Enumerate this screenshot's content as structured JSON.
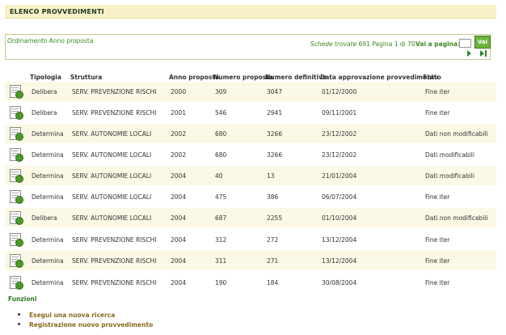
{
  "page": {
    "title": "ELENCO PROVVEDIMENTI"
  },
  "pager": {
    "sort_label": "Ordinamento",
    "sort_value": "Anno proposta",
    "found_label": "Schede trovate",
    "found_count": "691",
    "page_label": "Pagina",
    "page_current": "1",
    "page_of": "di",
    "page_total": "70",
    "goto_label": "Vai a pagina:",
    "goto_value": "",
    "go_button": "Vai",
    "icons": {
      "next": "arrow-right-icon",
      "last": "arrow-last-icon"
    }
  },
  "table": {
    "columns": [
      "Tipologia",
      "Struttura",
      "Anno proposta",
      "Numero proposta",
      "Numero definitivo",
      "Data approvazione provvedimento",
      "Stato"
    ],
    "row_icon": "document-icon",
    "rows": [
      {
        "tipologia": "Delibera",
        "struttura": "SERV. PREVENZIONE RISCHI",
        "anno": "2000",
        "numero_proposta": "309",
        "numero_definitivo": "3047",
        "data": "01/12/2000",
        "stato": "Fine iter"
      },
      {
        "tipologia": "Delibera",
        "struttura": "SERV. PREVENZIONE RISCHI",
        "anno": "2001",
        "numero_proposta": "546",
        "numero_definitivo": "2941",
        "data": "09/11/2001",
        "stato": "Fine iter"
      },
      {
        "tipologia": "Determina",
        "struttura": "SERV. AUTONOMIE LOCALI",
        "anno": "2002",
        "numero_proposta": "680",
        "numero_definitivo": "3266",
        "data": "23/12/2002",
        "stato": "Dati non modificabili"
      },
      {
        "tipologia": "Determina",
        "struttura": "SERV. AUTONOMIE LOCALI",
        "anno": "2002",
        "numero_proposta": "680",
        "numero_definitivo": "3266",
        "data": "23/12/2002",
        "stato": "Dati modificabili"
      },
      {
        "tipologia": "Determina",
        "struttura": "SERV. AUTONOMIE LOCALI",
        "anno": "2004",
        "numero_proposta": "40",
        "numero_definitivo": "13",
        "data": "21/01/2004",
        "stato": "Dati modificabili"
      },
      {
        "tipologia": "Determina",
        "struttura": "SERV. AUTONOMIE LOCALI",
        "anno": "2004",
        "numero_proposta": "475",
        "numero_definitivo": "386",
        "data": "06/07/2004",
        "stato": "Fine iter"
      },
      {
        "tipologia": "Delibera",
        "struttura": "SERV. AUTONOMIE LOCALI",
        "anno": "2004",
        "numero_proposta": "687",
        "numero_definitivo": "2255",
        "data": "01/10/2004",
        "stato": "Dati non modificabili"
      },
      {
        "tipologia": "Determina",
        "struttura": "SERV. PREVENZIONE RISCHI",
        "anno": "2004",
        "numero_proposta": "312",
        "numero_definitivo": "272",
        "data": "13/12/2004",
        "stato": "Fine iter"
      },
      {
        "tipologia": "Determina",
        "struttura": "SERV. PREVENZIONE RISCHI",
        "anno": "2004",
        "numero_proposta": "311",
        "numero_definitivo": "271",
        "data": "13/12/2004",
        "stato": "Fine iter"
      },
      {
        "tipologia": "Determina",
        "struttura": "SERV. PREVENZIONE RISCHI",
        "anno": "2004",
        "numero_proposta": "190",
        "numero_definitivo": "184",
        "data": "30/08/2004",
        "stato": "Fine iter"
      }
    ]
  },
  "functions": {
    "title": "Funzioni",
    "items": [
      "Esegui una nuova ricerca",
      "Registrazione nuovo provvedimento"
    ]
  },
  "colors": {
    "header_bg": "#f7f0c8",
    "accent_green": "#3a8a1f",
    "row_alt": "#fbf9e6",
    "link": "#8a6a1a"
  }
}
